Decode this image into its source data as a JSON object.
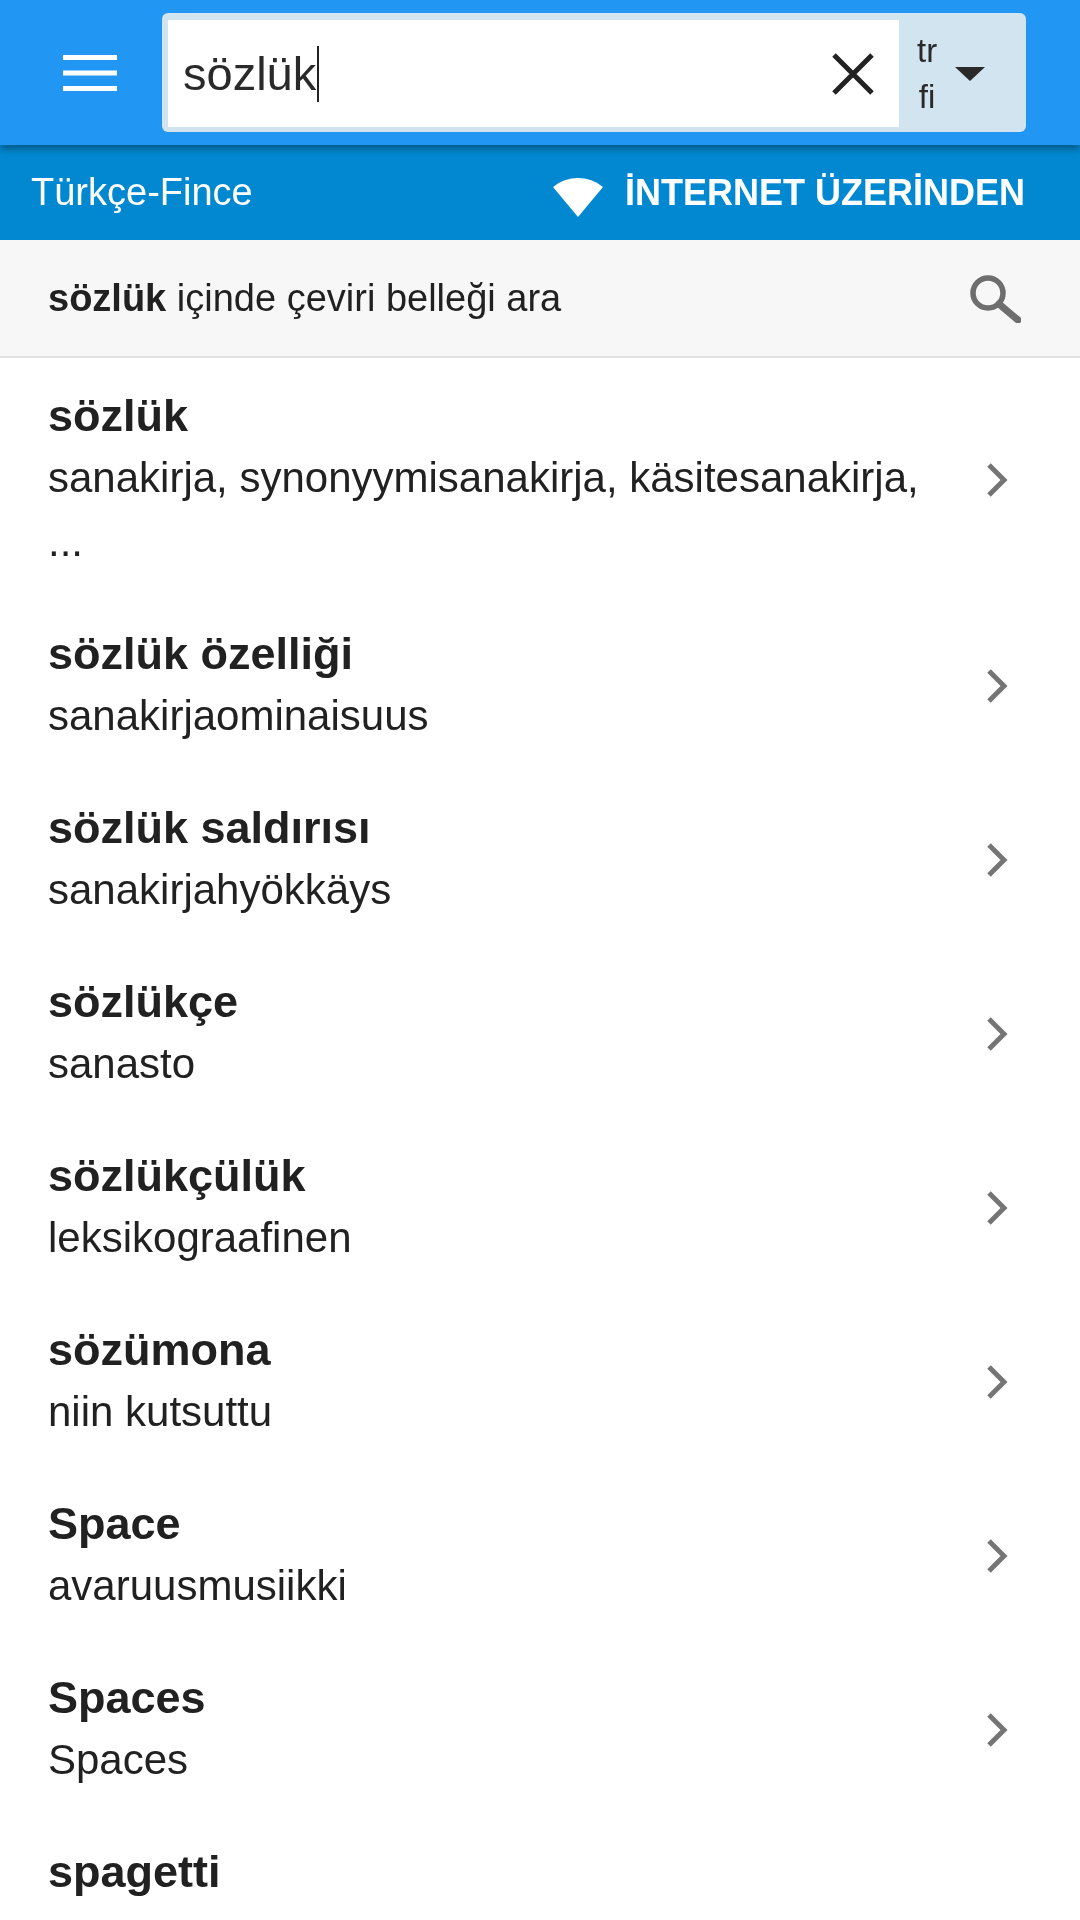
{
  "app_bar": {
    "search_field": {
      "value": "sözlük"
    },
    "language_selector": {
      "source": "tr",
      "target": "fi"
    }
  },
  "sub_bar": {
    "dictionary": "Türkçe-Fince",
    "mode_button": "İNTERNET ÜZERİNDEN"
  },
  "memory_search": {
    "text": "**sözlük** içinde çeviri belleği ara"
  },
  "results": [
    {
      "term": "sözlük",
      "translation": "sanakirja, synonyymisanakirja, käsitesanakirja, ..."
    },
    {
      "term": "sözlük özelliği",
      "translation": "sanakirjaominaisuus"
    },
    {
      "term": "sözlük saldırısı",
      "translation": "sanakirjahyökkäys"
    },
    {
      "term": "sözlükçe",
      "translation": "sanasto"
    },
    {
      "term": "sözlükçülük",
      "translation": "leksikograafinen"
    },
    {
      "term": "sözümona",
      "translation": "niin kutsuttu"
    },
    {
      "term": "Space",
      "translation": "avaruusmusiikki"
    },
    {
      "term": "Spaces",
      "translation": "Spaces"
    },
    {
      "term": "spagetti"
    }
  ]
}
